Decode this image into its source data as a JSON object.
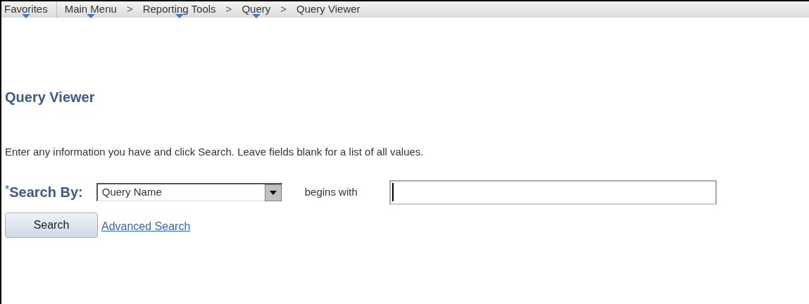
{
  "favorites": {
    "label": "Favorites",
    "has_menu": true
  },
  "breadcrumb": [
    {
      "label": "Main Menu",
      "has_menu": true
    },
    {
      "separator": ">",
      "label": "Reporting Tools",
      "has_menu": true
    },
    {
      "separator": ">",
      "label": "Query",
      "has_menu": true
    },
    {
      "separator": ">",
      "label": "Query Viewer",
      "has_menu": false
    }
  ],
  "page_title": "Query Viewer",
  "instructions": "Enter any information you have and click Search. Leave fields blank for a list of all values.",
  "search_by": {
    "required_mark": "*",
    "label": "Search By:",
    "value": "Query Name",
    "operator": "begins with"
  },
  "search_field": {
    "focused": true
  },
  "buttons": {
    "search": "Search",
    "advanced_search": "Advanced Search"
  }
}
